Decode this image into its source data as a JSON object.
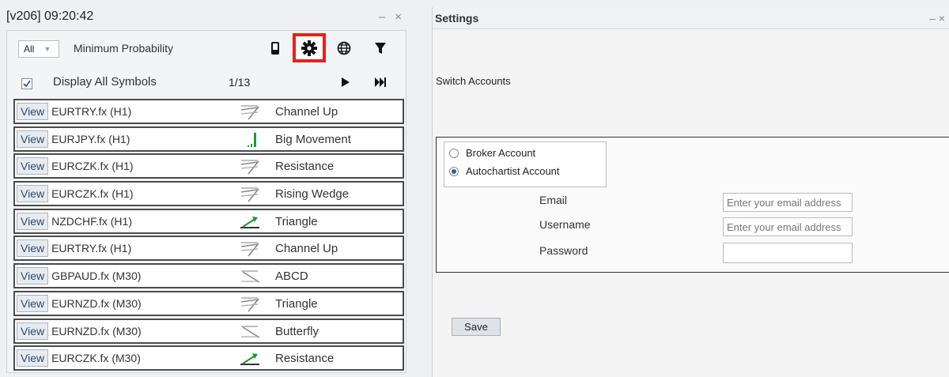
{
  "left_window": {
    "title": "[v206] 09:20:42",
    "minimize": "–",
    "close": "×",
    "filter_select": "All",
    "min_probability_label": "Minimum Probability",
    "display_all_label": "Display All Symbols",
    "display_all_checked": true,
    "page_counter": "1/13",
    "icons": [
      "mobile-icon",
      "gear-icon",
      "globe-icon",
      "filter-icon",
      "play-icon",
      "fast-forward-icon"
    ],
    "rows": [
      {
        "view": "View",
        "symbol": "EURTRY.fx (H1)",
        "pattern": "Channel Up",
        "icon": "trend-up"
      },
      {
        "view": "View",
        "symbol": "EURJPY.fx (H1)",
        "pattern": "Big Movement",
        "icon": "big-movement"
      },
      {
        "view": "View",
        "symbol": "EURCZK.fx (H1)",
        "pattern": "Resistance",
        "icon": "trend-up"
      },
      {
        "view": "View",
        "symbol": "EURCZK.fx (H1)",
        "pattern": "Rising Wedge",
        "icon": "trend-up"
      },
      {
        "view": "View",
        "symbol": "NZDCHF.fx (H1)",
        "pattern": "Triangle",
        "icon": "breakout-up"
      },
      {
        "view": "View",
        "symbol": "EURTRY.fx (H1)",
        "pattern": "Channel Up",
        "icon": "trend-up"
      },
      {
        "view": "View",
        "symbol": "GBPAUD.fx (M30)",
        "pattern": "ABCD",
        "icon": "trend-down"
      },
      {
        "view": "View",
        "symbol": "EURNZD.fx (M30)",
        "pattern": "Triangle",
        "icon": "trend-up"
      },
      {
        "view": "View",
        "symbol": "EURNZD.fx (M30)",
        "pattern": "Butterfly",
        "icon": "trend-down"
      },
      {
        "view": "View",
        "symbol": "EURCZK.fx (M30)",
        "pattern": "Resistance",
        "icon": "breakout-up"
      }
    ]
  },
  "settings_window": {
    "title": "Settings",
    "close": "– ×",
    "switch_accounts_label": "Switch Accounts",
    "account_options": [
      {
        "label": "Broker Account",
        "selected": false
      },
      {
        "label": "Autochartist Account",
        "selected": true
      }
    ],
    "fields": {
      "email_label": "Email",
      "email_placeholder": "Enter your email address",
      "username_label": "Username",
      "username_placeholder": "Enter your email address",
      "password_label": "Password",
      "password_value": ""
    },
    "save_label": "Save"
  },
  "colors": {
    "highlight_border": "#e2231a",
    "trend_green": "#1e9a2e"
  }
}
